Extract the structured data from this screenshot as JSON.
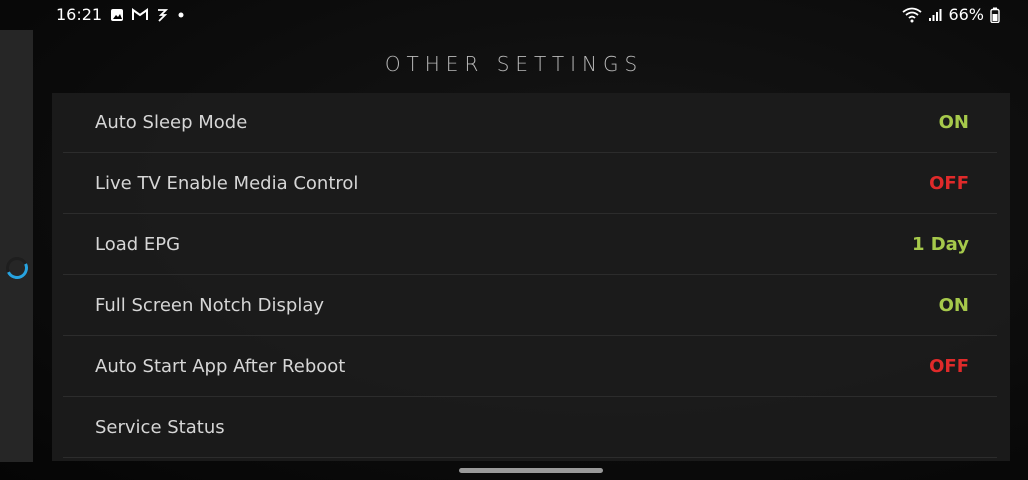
{
  "status_bar": {
    "time": "16:21",
    "battery": "66%",
    "left_icons": [
      "gallery-icon",
      "gmail-icon",
      "power-save-icon",
      "dot-icon"
    ],
    "right_icons": [
      "wifi-icon",
      "signal-icon",
      "battery-icon"
    ]
  },
  "page": {
    "title": "OTHER SETTINGS"
  },
  "settings": [
    {
      "label": "Auto Sleep Mode",
      "value": "ON",
      "state": "on"
    },
    {
      "label": "Live TV Enable Media Control",
      "value": "OFF",
      "state": "off"
    },
    {
      "label": "Load EPG",
      "value": "1 Day",
      "state": "neutral"
    },
    {
      "label": "Full Screen Notch Display",
      "value": "ON",
      "state": "on"
    },
    {
      "label": "Auto Start App After Reboot",
      "value": "OFF",
      "state": "off"
    },
    {
      "label": "Service Status",
      "value": "",
      "state": "none"
    }
  ],
  "colors": {
    "on": "#a6c94b",
    "off": "#e02a2a",
    "spinner_accent": "#27a3e0"
  }
}
